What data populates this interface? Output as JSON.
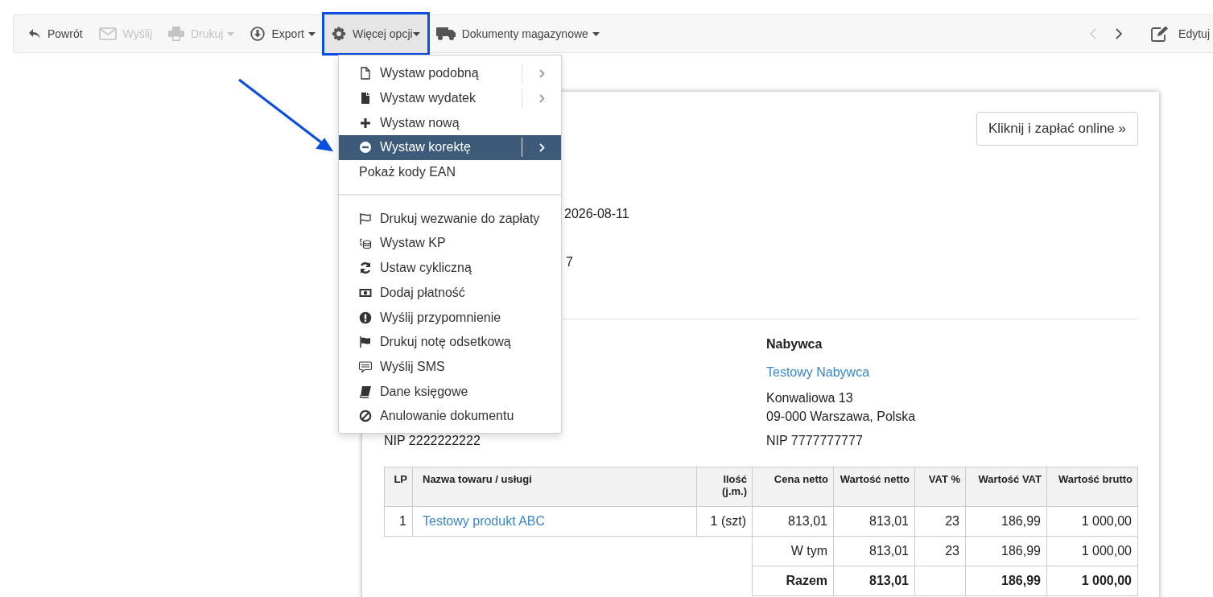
{
  "toolbar": {
    "buttons": [
      {
        "label": "Powrót",
        "dropdown": false,
        "disabled": false,
        "open": false
      },
      {
        "label": "Wyślij",
        "dropdown": false,
        "disabled": true,
        "open": false
      },
      {
        "label": "Drukuj",
        "dropdown": true,
        "disabled": true,
        "open": false
      },
      {
        "label": "Export",
        "dropdown": true,
        "disabled": false,
        "open": false
      },
      {
        "label": "Więcej opcji",
        "dropdown": true,
        "disabled": false,
        "open": true
      },
      {
        "label": "Dokumenty magazynowe",
        "dropdown": true,
        "disabled": false,
        "open": false
      }
    ],
    "pager": [
      {
        "disabled": true
      },
      {
        "disabled": false
      }
    ],
    "edit_button": {
      "label": "Edytuj"
    }
  },
  "menu": {
    "items": [
      {
        "kind": "item",
        "label": "Wystaw podobną",
        "submenu": true,
        "selected": false
      },
      {
        "kind": "item",
        "label": "Wystaw wydatek",
        "submenu": true,
        "selected": false
      },
      {
        "kind": "item",
        "label": "Wystaw nową",
        "submenu": false,
        "selected": false
      },
      {
        "kind": "item",
        "label": "Wystaw korektę",
        "submenu": true,
        "selected": true
      },
      {
        "kind": "item",
        "label": "Pokaż kody EAN",
        "submenu": false,
        "selected": false
      },
      {
        "kind": "separator"
      },
      {
        "kind": "item",
        "label": "Drukuj wezwanie do zapłaty",
        "submenu": false,
        "selected": false
      },
      {
        "kind": "item",
        "label": "Wystaw KP",
        "submenu": false,
        "selected": false
      },
      {
        "kind": "item",
        "label": "Ustaw cykliczną",
        "submenu": false,
        "selected": false
      },
      {
        "kind": "item",
        "label": "Dodaj płatność",
        "submenu": false,
        "selected": false
      },
      {
        "kind": "item",
        "label": "Wyślij przypomnienie",
        "submenu": false,
        "selected": false
      },
      {
        "kind": "item",
        "label": "Drukuj notę odsetkową",
        "submenu": false,
        "selected": false
      },
      {
        "kind": "item",
        "label": "Wyślij SMS",
        "submenu": false,
        "selected": false
      },
      {
        "kind": "item",
        "label": "Dane księgowe",
        "submenu": false,
        "selected": false
      },
      {
        "kind": "item",
        "label": "Anulowanie dokumentu",
        "submenu": false,
        "selected": false
      }
    ]
  },
  "annotation": {
    "frame": true,
    "arrow": true
  },
  "document": {
    "pay_button": "Kliknij i zapłać online »",
    "header_fragments": [
      "2026-08-11",
      "7"
    ],
    "seller": {
      "nip": "NIP 2222222222"
    },
    "buyer": {
      "heading": "Nabywca",
      "name": "Testowy Nabywca",
      "address": [
        "Konwaliowa 13",
        "09-000 Warszawa, Polska"
      ],
      "nip": "NIP 7777777777"
    },
    "table": {
      "columns": [
        "LP",
        "Nazwa towaru / usługi",
        "Ilość (j.m.)",
        "Cena netto",
        "Wartość netto",
        "VAT %",
        "Wartość VAT",
        "Wartość brutto"
      ],
      "rows": [
        [
          "1",
          "Testowy produkt ABC",
          "1 (szt)",
          "813,01",
          "813,01",
          "23",
          "186,99",
          "1 000,00"
        ]
      ],
      "summary": [
        {
          "label": "W tym",
          "bold": false,
          "cells": {
            "net_value": "813,01",
            "vat_rate": "23",
            "vat_value": "186,99",
            "gross_value": "1 000,00"
          }
        },
        {
          "label": "Razem",
          "bold": true,
          "cells": {
            "net_value": "813,01",
            "vat_value": "186,99",
            "gross_value": "1 000,00"
          }
        }
      ]
    }
  }
}
